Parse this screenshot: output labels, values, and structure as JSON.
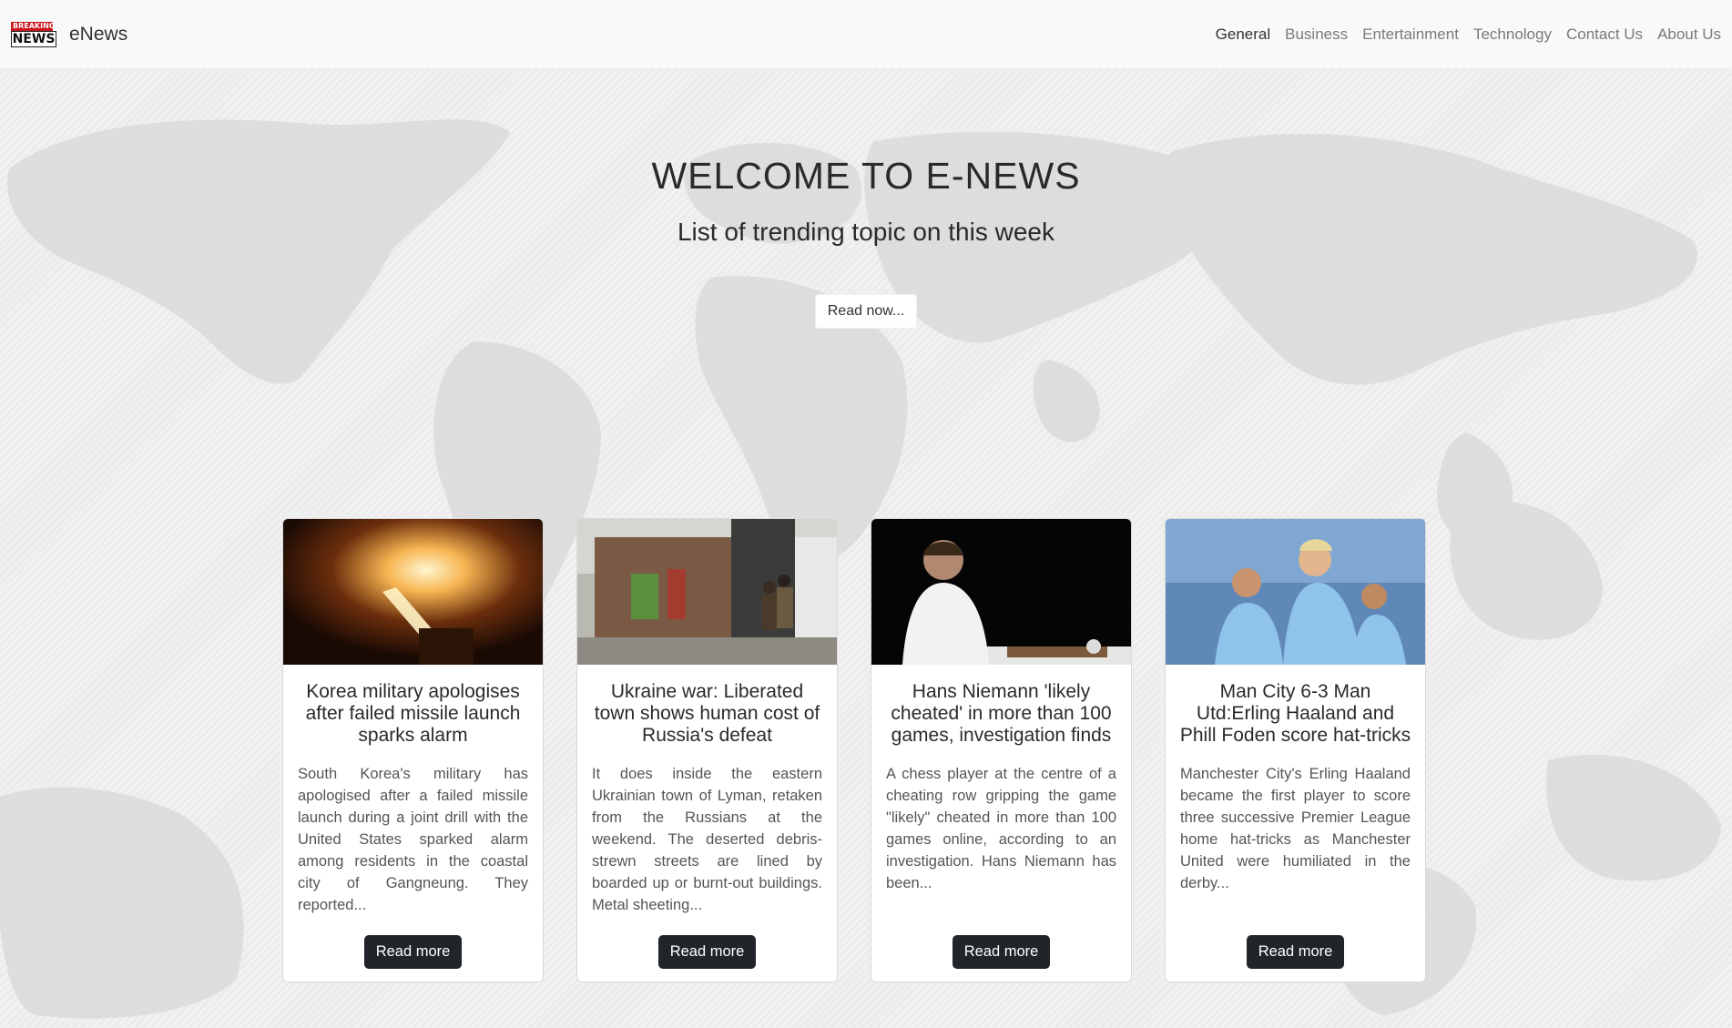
{
  "navbar": {
    "logo_top": "BREAKING",
    "logo_bottom": "NEWS",
    "brand": "eNews",
    "links": [
      "General",
      "Business",
      "Entertainment",
      "Technology",
      "Contact Us",
      "About Us"
    ]
  },
  "hero": {
    "title": "WELCOME TO E-NEWS",
    "subtitle": "List of trending topic on this week",
    "button": "Read now..."
  },
  "cards": [
    {
      "title": "Korea military apologises after failed missile launch sparks alarm",
      "text": "South Korea's military has apologised after a failed missile launch during a joint drill with the United States sparked alarm among residents in the coastal city of Gangneung. They reported...",
      "button": "Read more"
    },
    {
      "title": "Ukraine war: Liberated town shows human cost of Russia's defeat",
      "text": "It does inside the eastern Ukrainian town of Lyman, retaken from the Russians at the weekend. The deserted debris-strewn streets are lined by boarded up or burnt-out buildings. Metal sheeting...",
      "button": "Read more"
    },
    {
      "title": "Hans Niemann 'likely cheated' in more than 100 games, investigation finds",
      "text": "A chess player at the centre of a cheating row gripping the game \"likely\" cheated in more than 100 games online, according to an investigation. Hans Niemann has been...",
      "button": "Read more"
    },
    {
      "title": "Man City 6-3 Man Utd:Erling Haaland and Phill Foden score hat-tricks",
      "text": "Manchester City's Erling Haaland became the first player to score three successive Premier League home hat-tricks as Manchester United were humiliated in the derby...",
      "button": "Read more"
    }
  ]
}
